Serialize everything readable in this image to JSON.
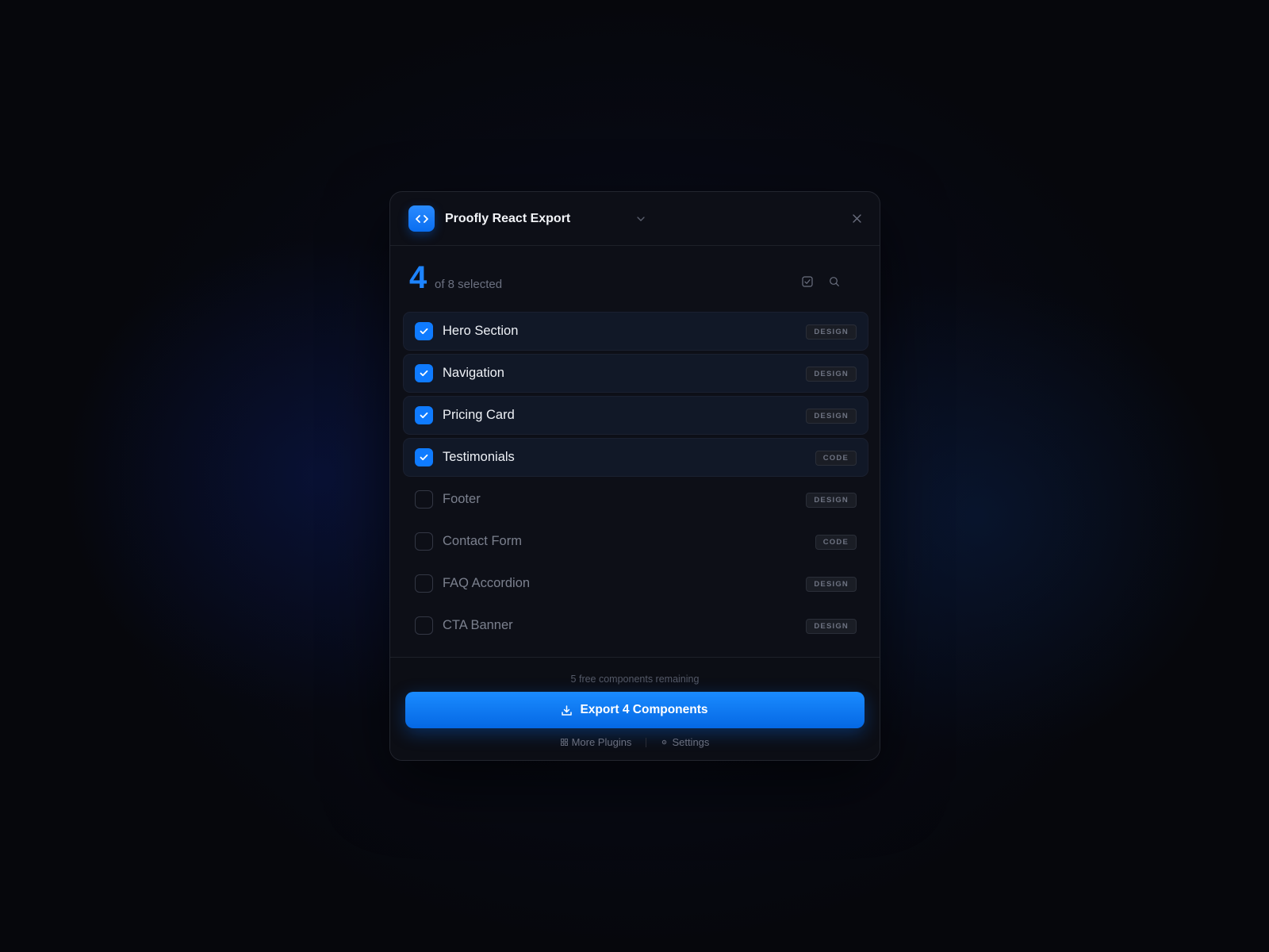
{
  "header": {
    "app_title": "Proofly React Export",
    "app_icon": "code-brackets-icon"
  },
  "summary": {
    "selected_count": "4",
    "of_text": "of 8 selected"
  },
  "components": [
    {
      "name": "Hero Section",
      "tag": "DESIGN",
      "checked": true
    },
    {
      "name": "Navigation",
      "tag": "DESIGN",
      "checked": true
    },
    {
      "name": "Pricing Card",
      "tag": "DESIGN",
      "checked": true
    },
    {
      "name": "Testimonials",
      "tag": "CODE",
      "checked": true
    },
    {
      "name": "Footer",
      "tag": "DESIGN",
      "checked": false
    },
    {
      "name": "Contact Form",
      "tag": "CODE",
      "checked": false
    },
    {
      "name": "FAQ Accordion",
      "tag": "DESIGN",
      "checked": false
    },
    {
      "name": "CTA Banner",
      "tag": "DESIGN",
      "checked": false
    }
  ],
  "footer": {
    "remaining_text": "5 free components remaining",
    "export_label": "Export 4 Components",
    "more_plugins_label": "More Plugins",
    "settings_label": "Settings"
  },
  "colors": {
    "accent": "#0f7bff",
    "background": "#070912",
    "panel": "#0d0f17"
  }
}
